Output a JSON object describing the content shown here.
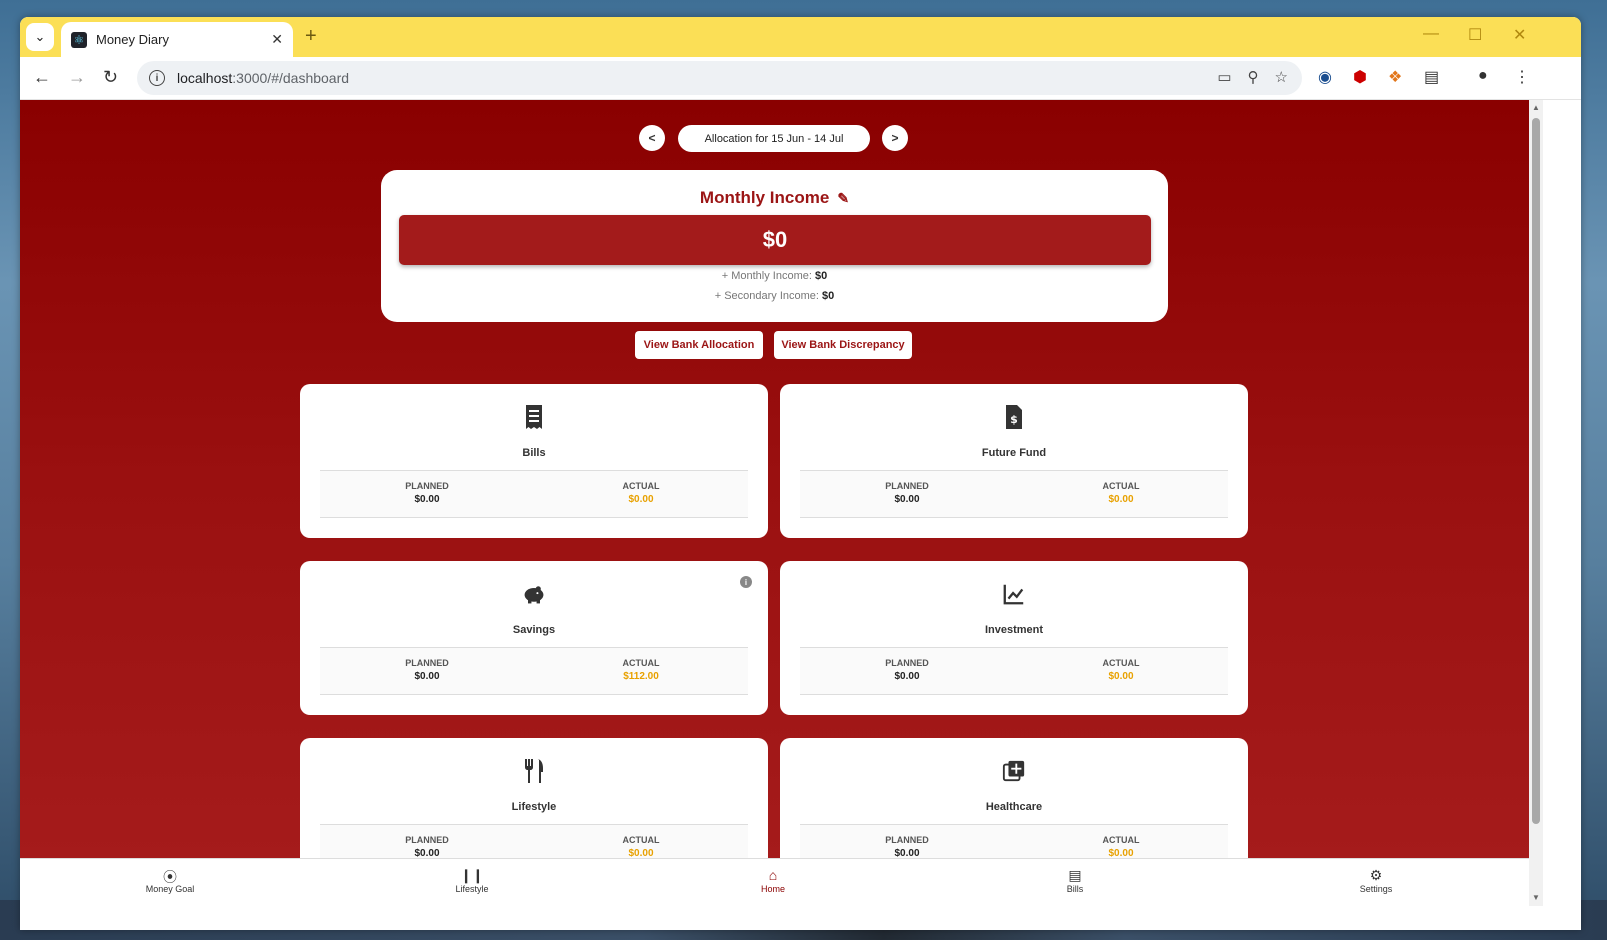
{
  "browser": {
    "tab_title": "Money Diary",
    "url_host": "localhost",
    "url_rest": ":3000/#/dashboard",
    "new_tab": "+"
  },
  "period": {
    "prev": "<",
    "label": "Allocation for 15 Jun - 14 Jul",
    "next": ">"
  },
  "income": {
    "title": "Monthly Income",
    "total": "$0",
    "monthly_label": "+ Monthly Income: ",
    "monthly_value": "$0",
    "secondary_label": "+ Secondary Income: ",
    "secondary_value": "$0"
  },
  "bank_buttons": {
    "allocation": "View Bank Allocation",
    "discrepancy": "View Bank Discrepancy"
  },
  "categories": [
    {
      "name": "Bills",
      "icon": "receipt-icon",
      "planned_label": "PLANNED",
      "planned": "$0.00",
      "actual_label": "ACTUAL",
      "actual": "$0.00"
    },
    {
      "name": "Future Fund",
      "icon": "file-invoice-dollar-icon",
      "planned_label": "PLANNED",
      "planned": "$0.00",
      "actual_label": "ACTUAL",
      "actual": "$0.00"
    },
    {
      "name": "Savings",
      "icon": "piggy-bank-icon",
      "planned_label": "PLANNED",
      "planned": "$0.00",
      "actual_label": "ACTUAL",
      "actual": "$112.00"
    },
    {
      "name": "Investment",
      "icon": "chart-line-icon",
      "planned_label": "PLANNED",
      "planned": "$0.00",
      "actual_label": "ACTUAL",
      "actual": "$0.00"
    },
    {
      "name": "Lifestyle",
      "icon": "utensils-icon",
      "planned_label": "PLANNED",
      "planned": "$0.00",
      "actual_label": "ACTUAL",
      "actual": "$0.00"
    },
    {
      "name": "Healthcare",
      "icon": "medical-plus-icon",
      "planned_label": "PLANNED",
      "planned": "$0.00",
      "actual_label": "ACTUAL",
      "actual": "$0.00"
    }
  ],
  "bottom_nav": [
    {
      "label": "Money Goal",
      "icon": "compass-icon"
    },
    {
      "label": "Lifestyle",
      "icon": "utensils-icon"
    },
    {
      "label": "Home",
      "icon": "home-icon",
      "active": true
    },
    {
      "label": "Bills",
      "icon": "receipt-icon"
    },
    {
      "label": "Settings",
      "icon": "gear-icon"
    }
  ],
  "colors": {
    "accent": "#8a0000",
    "actual_value": "#e8a100",
    "tabstrip": "#fbdf56"
  }
}
